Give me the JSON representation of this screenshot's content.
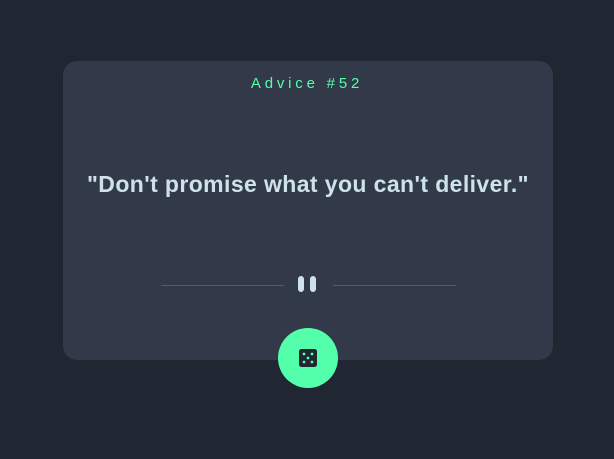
{
  "advice": {
    "heading": "Advice #52",
    "quote": "\"Don't promise what you can't deliver.\""
  },
  "icons": {
    "divider": "pause-icon",
    "button": "dice-icon"
  },
  "colors": {
    "background": "#202632",
    "card": "#323a49",
    "accent": "#53ffaa",
    "text": "#cee3e9",
    "divider": "#4f5d74"
  }
}
